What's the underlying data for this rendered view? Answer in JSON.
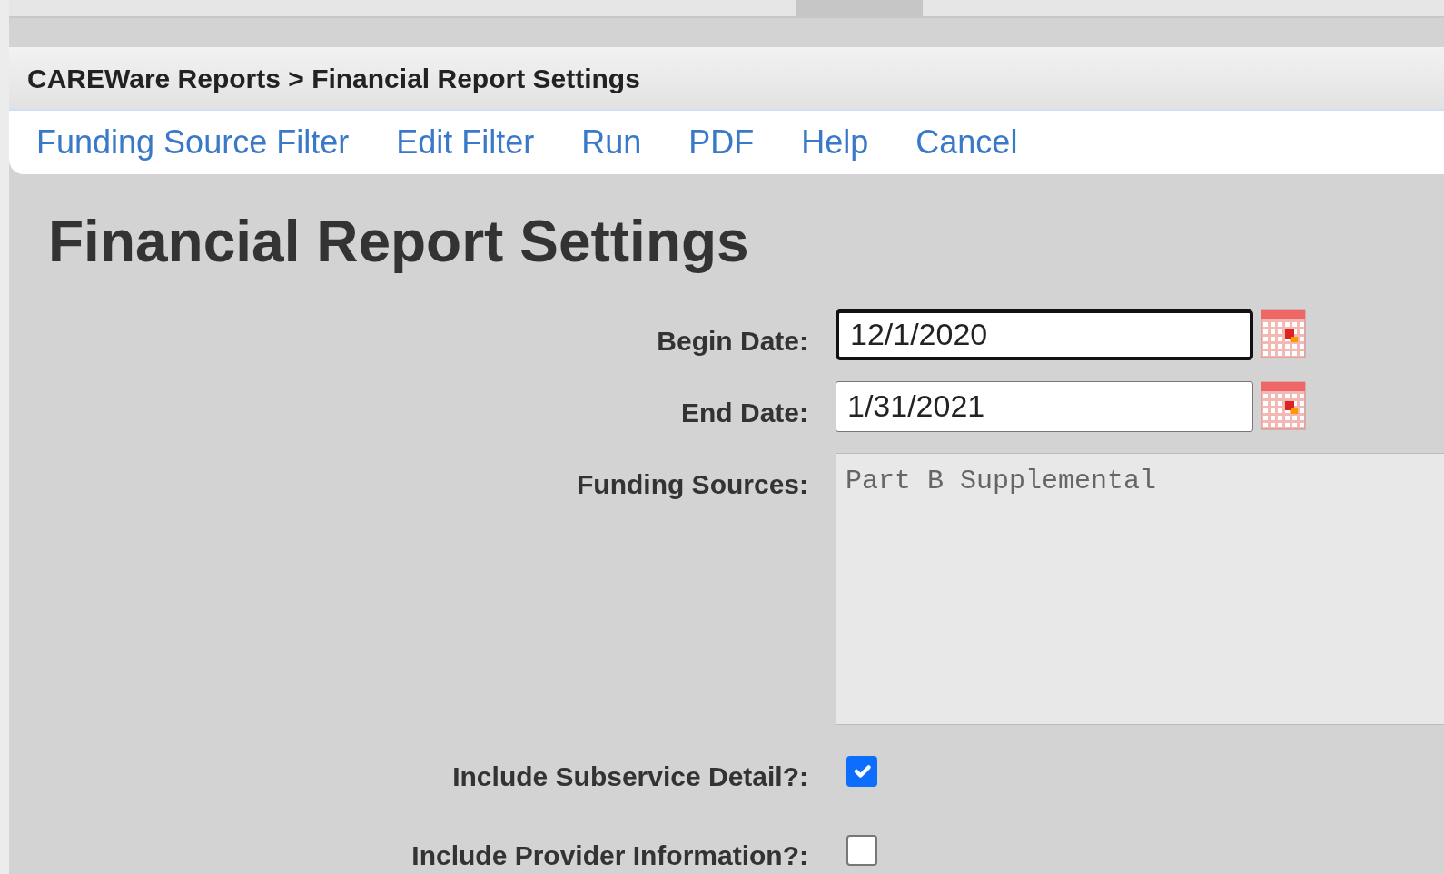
{
  "breadcrumb": "CAREWare Reports > Financial Report Settings",
  "menu": [
    {
      "label": "Funding Source Filter"
    },
    {
      "label": "Edit Filter"
    },
    {
      "label": "Run"
    },
    {
      "label": "PDF"
    },
    {
      "label": "Help"
    },
    {
      "label": "Cancel"
    }
  ],
  "heading": "Financial Report Settings",
  "fields": [
    {
      "kind": "date",
      "label": "Begin Date:",
      "value": "12/1/2020",
      "focused": true
    },
    {
      "kind": "date",
      "label": "End Date:",
      "value": "1/31/2021",
      "focused": false
    },
    {
      "kind": "list",
      "label": "Funding Sources:",
      "value": "Part B Supplemental"
    },
    {
      "kind": "checkbox",
      "label": "Include Subservice Detail?:",
      "checked": true
    },
    {
      "kind": "checkbox",
      "label": "Include Provider Information?:",
      "checked": false
    }
  ]
}
